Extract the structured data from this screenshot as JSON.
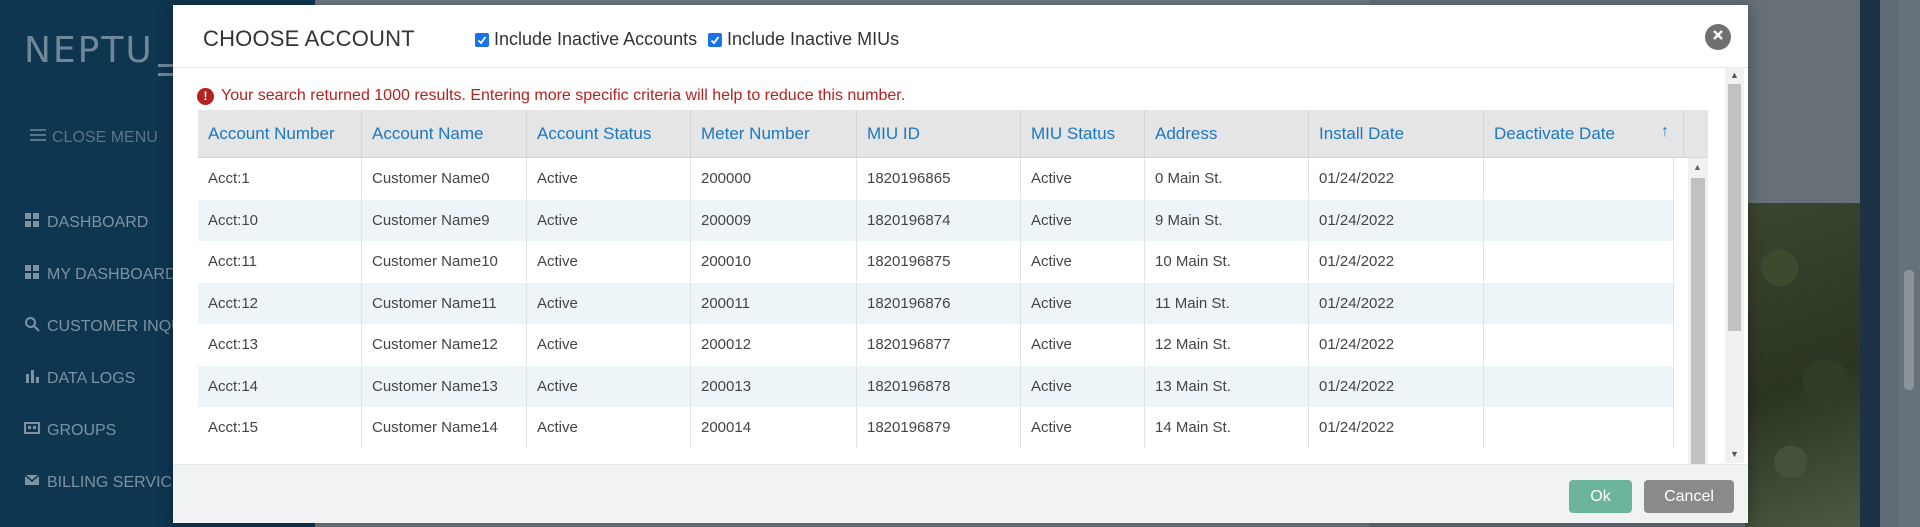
{
  "background": {
    "logo_text": "NEPTU",
    "close_menu_label": "CLOSE MENU",
    "nav": [
      {
        "label": "DASHBOARD",
        "icon": "grid-icon"
      },
      {
        "label": "MY DASHBOARD",
        "icon": "grid-icon"
      },
      {
        "label": "CUSTOMER INQU",
        "icon": "search-icon"
      },
      {
        "label": "DATA LOGS",
        "icon": "bar-chart-icon"
      },
      {
        "label": "GROUPS",
        "icon": "groups-icon"
      },
      {
        "label": "BILLING SERVICE",
        "icon": "envelope-icon"
      }
    ]
  },
  "modal": {
    "title": "CHOOSE ACCOUNT",
    "include_inactive_accounts": {
      "label": "Include Inactive Accounts",
      "checked": true
    },
    "include_inactive_mius": {
      "label": "Include Inactive MIUs",
      "checked": true
    },
    "warning": "Your search returned 1000 results. Entering more specific criteria will help to reduce this number.",
    "columns": [
      "Account Number",
      "Account Name",
      "Account Status",
      "Meter Number",
      "MIU ID",
      "MIU Status",
      "Address",
      "Install Date",
      "Deactivate Date"
    ],
    "sorted_column": "Deactivate Date",
    "sort_direction": "ascending",
    "rows": [
      [
        "Acct:1",
        "Customer Name0",
        "Active",
        "200000",
        "1820196865",
        "Active",
        "0 Main St.",
        "01/24/2022",
        ""
      ],
      [
        "Acct:10",
        "Customer Name9",
        "Active",
        "200009",
        "1820196874",
        "Active",
        "9 Main St.",
        "01/24/2022",
        ""
      ],
      [
        "Acct:11",
        "Customer Name10",
        "Active",
        "200010",
        "1820196875",
        "Active",
        "10 Main St.",
        "01/24/2022",
        ""
      ],
      [
        "Acct:12",
        "Customer Name11",
        "Active",
        "200011",
        "1820196876",
        "Active",
        "11 Main St.",
        "01/24/2022",
        ""
      ],
      [
        "Acct:13",
        "Customer Name12",
        "Active",
        "200012",
        "1820196877",
        "Active",
        "12 Main St.",
        "01/24/2022",
        ""
      ],
      [
        "Acct:14",
        "Customer Name13",
        "Active",
        "200013",
        "1820196878",
        "Active",
        "13 Main St.",
        "01/24/2022",
        ""
      ],
      [
        "Acct:15",
        "Customer Name14",
        "Active",
        "200014",
        "1820196879",
        "Active",
        "14 Main St.",
        "01/24/2022",
        ""
      ]
    ],
    "ok_label": "Ok",
    "cancel_label": "Cancel"
  },
  "colors": {
    "header_link": "#1a78c2",
    "warning": "#b4221f",
    "ok_button": "#6db59a",
    "cancel_button": "#8a8a8a",
    "sidebar": "#0e3650",
    "row_alt": "#eef5f9"
  }
}
